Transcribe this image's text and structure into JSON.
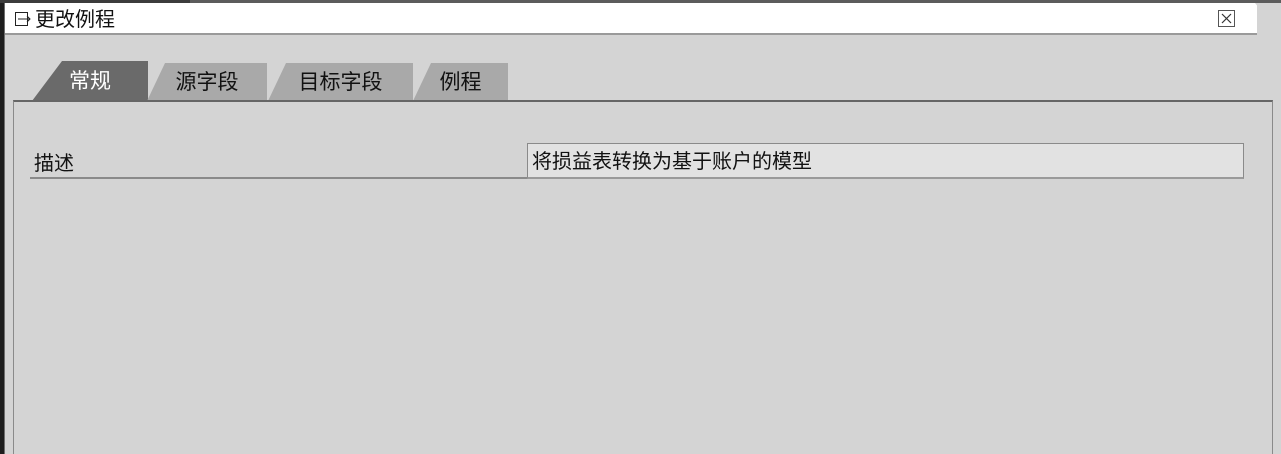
{
  "window": {
    "title": "更改例程",
    "icon": "edit-window-icon",
    "close_icon": "close-icon"
  },
  "tabs": [
    {
      "label": "常规",
      "active": true
    },
    {
      "label": "源字段",
      "active": false
    },
    {
      "label": "目标字段",
      "active": false
    },
    {
      "label": "例程",
      "active": false
    }
  ],
  "form": {
    "description_label": "描述",
    "description_value": "将损益表转换为基于账户的模型"
  },
  "colors": {
    "active_tab": "#6a6a6a",
    "inactive_tab": "#a9a9a9",
    "panel_bg": "#d4d4d4",
    "titlebar_bg": "#ffffff"
  }
}
